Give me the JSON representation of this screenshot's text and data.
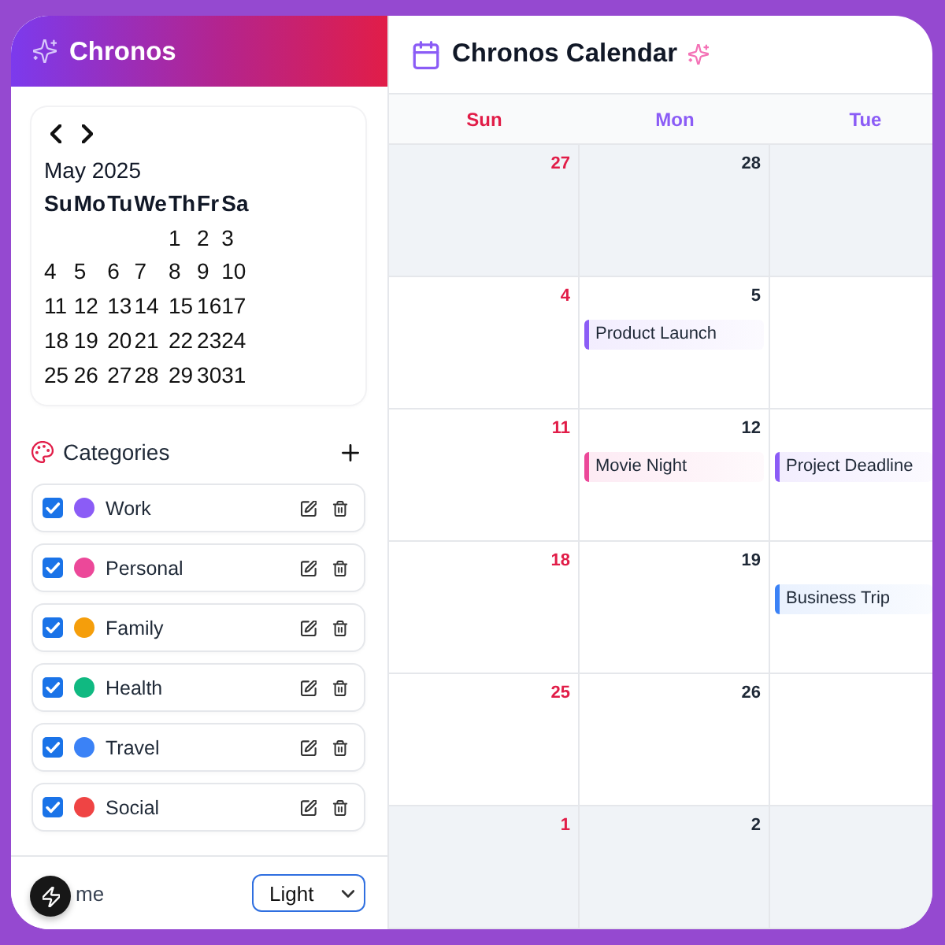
{
  "sidebar": {
    "title": "Chronos",
    "mini_calendar": {
      "month": "May 2025",
      "weekdays": [
        "Su",
        "Mo",
        "Tu",
        "We",
        "Th",
        "Fr",
        "Sa"
      ],
      "weeks": [
        [
          "1",
          "2",
          "3"
        ],
        [
          "4",
          "5",
          "6",
          "7",
          "8",
          "9",
          "10"
        ],
        [
          "11",
          "12",
          "13",
          "14",
          "15",
          "16",
          "17"
        ],
        [
          "18",
          "19",
          "20",
          "21",
          "22",
          "23",
          "24"
        ],
        [
          "25",
          "26",
          "27",
          "28",
          "29",
          "30",
          "31"
        ]
      ]
    },
    "categories_heading": "Categories",
    "categories": [
      {
        "name": "Work",
        "color": "#8b5cf6",
        "checked": true
      },
      {
        "name": "Personal",
        "color": "#ec4899",
        "checked": true
      },
      {
        "name": "Family",
        "color": "#f59e0b",
        "checked": true
      },
      {
        "name": "Health",
        "color": "#10b981",
        "checked": true
      },
      {
        "name": "Travel",
        "color": "#3b82f6",
        "checked": true
      },
      {
        "name": "Social",
        "color": "#ef4444",
        "checked": true
      }
    ],
    "theme": {
      "label": "me",
      "value": "Light"
    }
  },
  "calendar": {
    "title": "Chronos Calendar",
    "weekdays": [
      {
        "label": "Sun",
        "kind": "weekend"
      },
      {
        "label": "Mon",
        "kind": "weekday"
      },
      {
        "label": "Tue",
        "kind": "weekday"
      }
    ],
    "weeks": [
      [
        {
          "day": "27",
          "outside_month": true
        },
        {
          "day": "28",
          "outside_month": true
        },
        {
          "outside_month": true
        }
      ],
      [
        {
          "day": "4",
          "outside_month": false
        },
        {
          "day": "5",
          "outside_month": false,
          "events": [
            {
              "title": "Product Launch",
              "color": "#8b5cf6"
            }
          ]
        },
        {
          "outside_month": false
        }
      ],
      [
        {
          "day": "11",
          "outside_month": false
        },
        {
          "day": "12",
          "outside_month": false,
          "events": [
            {
              "title": "Movie Night",
              "color": "#ec4899"
            }
          ]
        },
        {
          "outside_month": false,
          "events": [
            {
              "title": "Project Deadline",
              "color": "#8b5cf6"
            }
          ]
        }
      ],
      [
        {
          "day": "18",
          "outside_month": false
        },
        {
          "day": "19",
          "outside_month": false
        },
        {
          "outside_month": false,
          "events": [
            {
              "title": "Business Trip",
              "color": "#3b82f6"
            }
          ]
        }
      ],
      [
        {
          "day": "25",
          "outside_month": false
        },
        {
          "day": "26",
          "outside_month": false
        },
        {
          "outside_month": false
        }
      ],
      [
        {
          "day": "1",
          "outside_month": true
        },
        {
          "day": "2",
          "outside_month": true
        },
        {
          "outside_month": true
        }
      ]
    ]
  }
}
